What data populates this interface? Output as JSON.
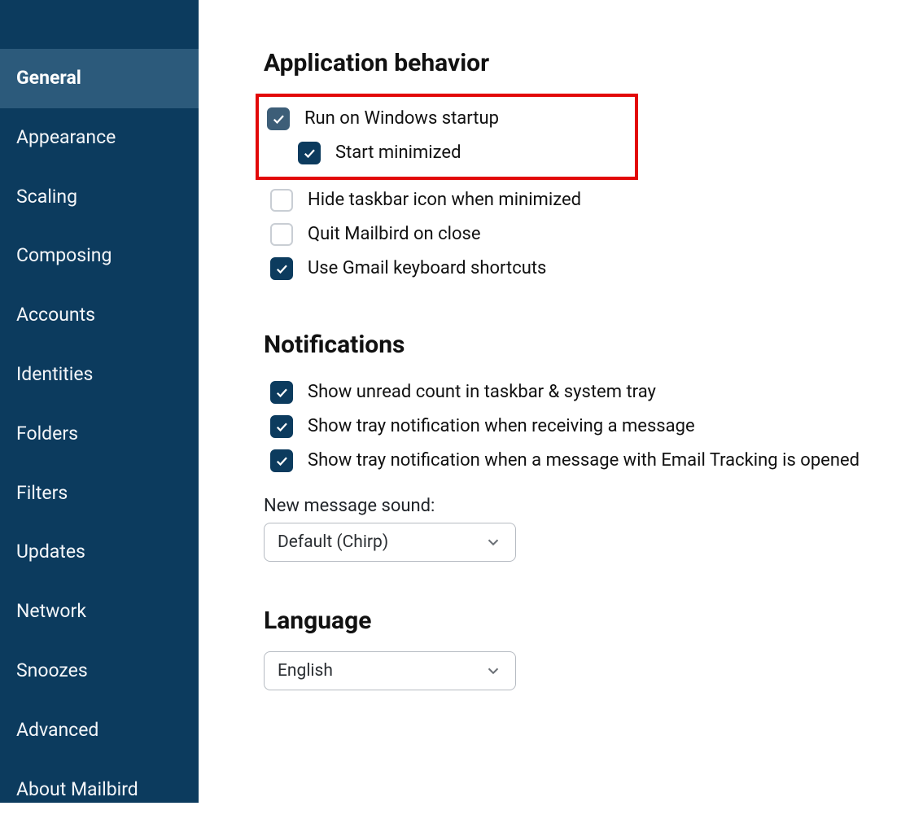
{
  "sidebar": {
    "items": [
      {
        "label": "General",
        "active": true
      },
      {
        "label": "Appearance",
        "active": false
      },
      {
        "label": "Scaling",
        "active": false
      },
      {
        "label": "Composing",
        "active": false
      },
      {
        "label": "Accounts",
        "active": false
      },
      {
        "label": "Identities",
        "active": false
      },
      {
        "label": "Folders",
        "active": false
      },
      {
        "label": "Filters",
        "active": false
      },
      {
        "label": "Updates",
        "active": false
      },
      {
        "label": "Network",
        "active": false
      },
      {
        "label": "Snoozes",
        "active": false
      },
      {
        "label": "Advanced",
        "active": false
      },
      {
        "label": "About Mailbird",
        "active": false
      }
    ]
  },
  "sections": {
    "appBehavior": {
      "title": "Application behavior",
      "items": {
        "runOnStartup": {
          "label": "Run on Windows startup",
          "checked": true,
          "muted": true
        },
        "startMinimized": {
          "label": "Start minimized",
          "checked": true,
          "muted": false
        },
        "hideTaskbar": {
          "label": "Hide taskbar icon when minimized",
          "checked": false
        },
        "quitOnClose": {
          "label": "Quit Mailbird on close",
          "checked": false
        },
        "gmailShortcuts": {
          "label": "Use Gmail keyboard shortcuts",
          "checked": true,
          "muted": false
        }
      }
    },
    "notifications": {
      "title": "Notifications",
      "items": {
        "unreadCount": {
          "label": "Show unread count in taskbar & system tray",
          "checked": true
        },
        "trayOnReceive": {
          "label": "Show tray notification when receiving a message",
          "checked": true
        },
        "trayOnTracked": {
          "label": "Show tray notification when a message with Email Tracking is opened",
          "checked": true
        }
      },
      "soundLabel": "New message sound:",
      "soundValue": "Default (Chirp)"
    },
    "language": {
      "title": "Language",
      "value": "English"
    }
  }
}
